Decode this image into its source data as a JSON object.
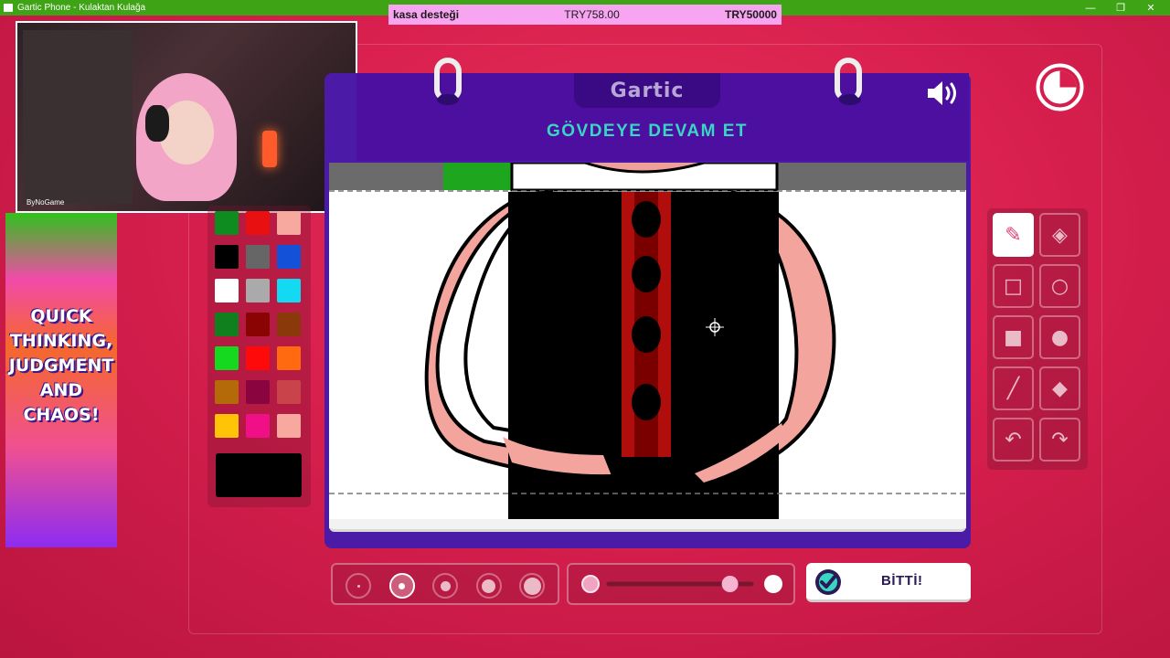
{
  "window": {
    "title": "Gartic Phone - Kulaktan Kulağa",
    "controls": [
      "—",
      "❐",
      "✕"
    ]
  },
  "donation": {
    "label": "kasa desteği",
    "current": "TRY758.00",
    "goal": "TRY50000"
  },
  "webcam": {
    "tag": "ByNoGame"
  },
  "ad": {
    "lines": [
      "QUICK",
      "THINKING,",
      "JUDGMENT",
      "AND",
      "CHAOS!"
    ]
  },
  "game": {
    "logo": "Gartic",
    "prompt": "GÖVDEYE DEVAM ET",
    "done_label": "BİTTİ!",
    "timer_remaining_fraction": 0.75
  },
  "palette": {
    "colors": [
      "#0f8c1f",
      "#e81010",
      "#f7a9a0",
      "#000000",
      "#666666",
      "#1451d9",
      "#ffffff",
      "#aaaaaa",
      "#14d9f2",
      "#10801f",
      "#8a0404",
      "#8a3a0a",
      "#14d91f",
      "#ff0a0a",
      "#ff6a10",
      "#b56a0a",
      "#8a0440",
      "#c9444a",
      "#ffc408",
      "#ef1088",
      "#f7a9a0"
    ],
    "selected": "#000000"
  },
  "tools": [
    {
      "name": "pencil-icon",
      "glyph": "✎",
      "active": true
    },
    {
      "name": "eraser-icon",
      "glyph": "◈",
      "active": false
    },
    {
      "name": "rectangle-outline-icon",
      "glyph": "□",
      "active": false
    },
    {
      "name": "circle-outline-icon",
      "glyph": "○",
      "active": false
    },
    {
      "name": "rectangle-filled-icon",
      "glyph": "■",
      "active": false
    },
    {
      "name": "circle-filled-icon",
      "glyph": "●",
      "active": false
    },
    {
      "name": "line-icon",
      "glyph": "╱",
      "active": false
    },
    {
      "name": "fill-bucket-icon",
      "glyph": "◆",
      "active": false
    },
    {
      "name": "undo-icon",
      "glyph": "↶",
      "active": false
    },
    {
      "name": "redo-icon",
      "glyph": "↷",
      "active": false
    }
  ],
  "brush_sizes": {
    "count": 5,
    "selected_index": 1
  },
  "opacity": {
    "value": 0.85
  },
  "colors": {
    "accent_teal": "#39d7c3",
    "book_purple": "#4c0fa0",
    "background_red": "#d81f4e"
  }
}
